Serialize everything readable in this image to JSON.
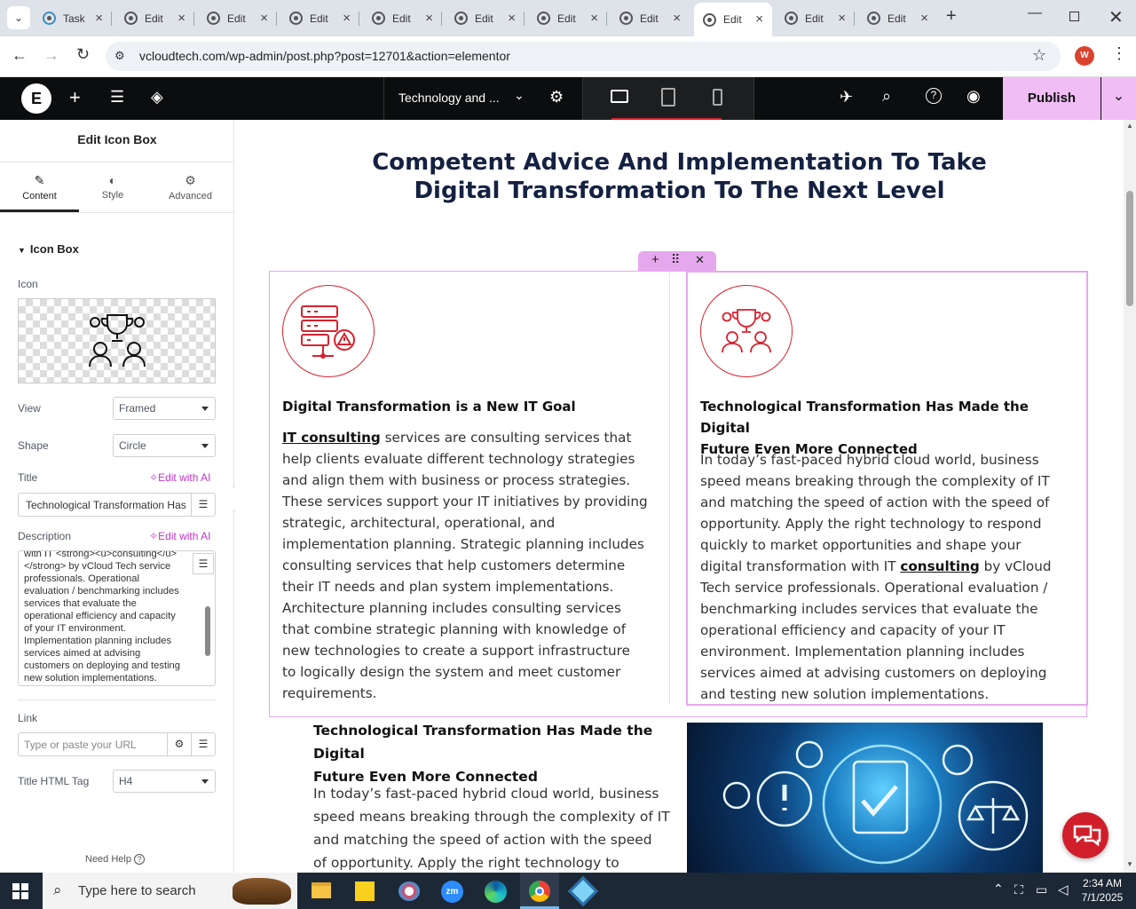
{
  "tabs": [
    {
      "label": "Task",
      "active": false
    },
    {
      "label": "Edit",
      "active": false
    },
    {
      "label": "Edit",
      "active": false
    },
    {
      "label": "Edit",
      "active": false
    },
    {
      "label": "Edit",
      "active": false
    },
    {
      "label": "Edit",
      "active": false
    },
    {
      "label": "Edit",
      "active": false
    },
    {
      "label": "Edit",
      "active": false
    },
    {
      "label": "Edit",
      "active": true
    },
    {
      "label": "Edit",
      "active": false
    },
    {
      "label": "Edit",
      "active": false
    }
  ],
  "address": {
    "url": "vcloudtech.com/wp-admin/post.php?post=12701&action=elementor",
    "profile_initial": "W"
  },
  "elementor": {
    "page_name": "Technology and ...",
    "publish": "Publish"
  },
  "panel": {
    "title": "Edit Icon Box",
    "tabs": {
      "content": "Content",
      "style": "Style",
      "advanced": "Advanced"
    },
    "section": "Icon Box",
    "icon_label": "Icon",
    "view_label": "View",
    "view_value": "Framed",
    "shape_label": "Shape",
    "shape_value": "Circle",
    "title_label": "Title",
    "edit_ai": "Edit with AI",
    "title_value": "Technological Transformation Has",
    "desc_label": "Description",
    "desc_lines": [
      "with IT <strong><u>consulting</u>",
      "</strong> by vCloud Tech service",
      "professionals. Operational",
      "evaluation / benchmarking includes",
      "services that evaluate the",
      "operational efficiency and capacity",
      "of your IT environment.",
      "Implementation planning includes",
      "services aimed at advising",
      "customers on deploying and testing",
      "new solution implementations."
    ],
    "link_label": "Link",
    "link_placeholder": "Type or paste your URL",
    "html_tag_label": "Title HTML Tag",
    "html_tag_value": "H4",
    "need_help": "Need Help"
  },
  "canvas": {
    "heading_line1": "Competent Advice And Implementation To Take",
    "heading_line2": "Digital Transformation To The Next Level",
    "box1": {
      "title": "Digital Transformation is a New IT Goal",
      "link": "IT consulting",
      "lines": [
        " services are consulting services that",
        "help clients evaluate different technology strategies",
        "and align them with business or process strategies.",
        "These services support your IT initiatives by providing",
        "strategic, architectural, operational, and",
        "implementation planning. Strategic planning includes",
        "consulting services that help customers determine",
        "their IT needs and plan system implementations.",
        "Architecture planning includes consulting services",
        "that combine strategic planning with knowledge of",
        "new technologies to create a support infrastructure",
        "to logically design the system and meet customer",
        "requirements."
      ]
    },
    "box2": {
      "title_line1": "Technological Transformation Has Made the Digital",
      "title_line2": "Future Even More Connected",
      "lines": [
        "In today’s fast-paced hybrid cloud world, business",
        "speed means breaking through the complexity of IT",
        "and matching the speed of action with the speed of",
        "opportunity. Apply the right technology to respond",
        "quickly to market opportunities and shape your"
      ],
      "line6_pre": "digital transformation with IT ",
      "line6_link": "consulting",
      "line6_post": " by vCloud",
      "lines_after": [
        "Tech service professionals. Operational evaluation /",
        "benchmarking includes services that evaluate the",
        "operational efficiency and capacity of your IT",
        "environment. Implementation planning includes",
        "services aimed at advising customers on deploying",
        "and testing new solution implementations."
      ]
    },
    "bottom": {
      "title_line1": "Technological Transformation Has Made the Digital",
      "title_line2": "Future Even More Connected",
      "lines": [
        "In today’s fast-paced hybrid cloud world, business",
        "speed means breaking through the complexity of IT",
        "and matching the speed of action with the speed",
        "of opportunity. Apply the right technology to"
      ]
    }
  },
  "taskbar": {
    "search_placeholder": "Type here to search",
    "time": "2:34 AM",
    "date": "7/1/2025"
  },
  "colors": {
    "accent": "#d8222e",
    "publish": "#f0bdf5",
    "heading": "#152141",
    "selection": "#e6a8ec"
  }
}
